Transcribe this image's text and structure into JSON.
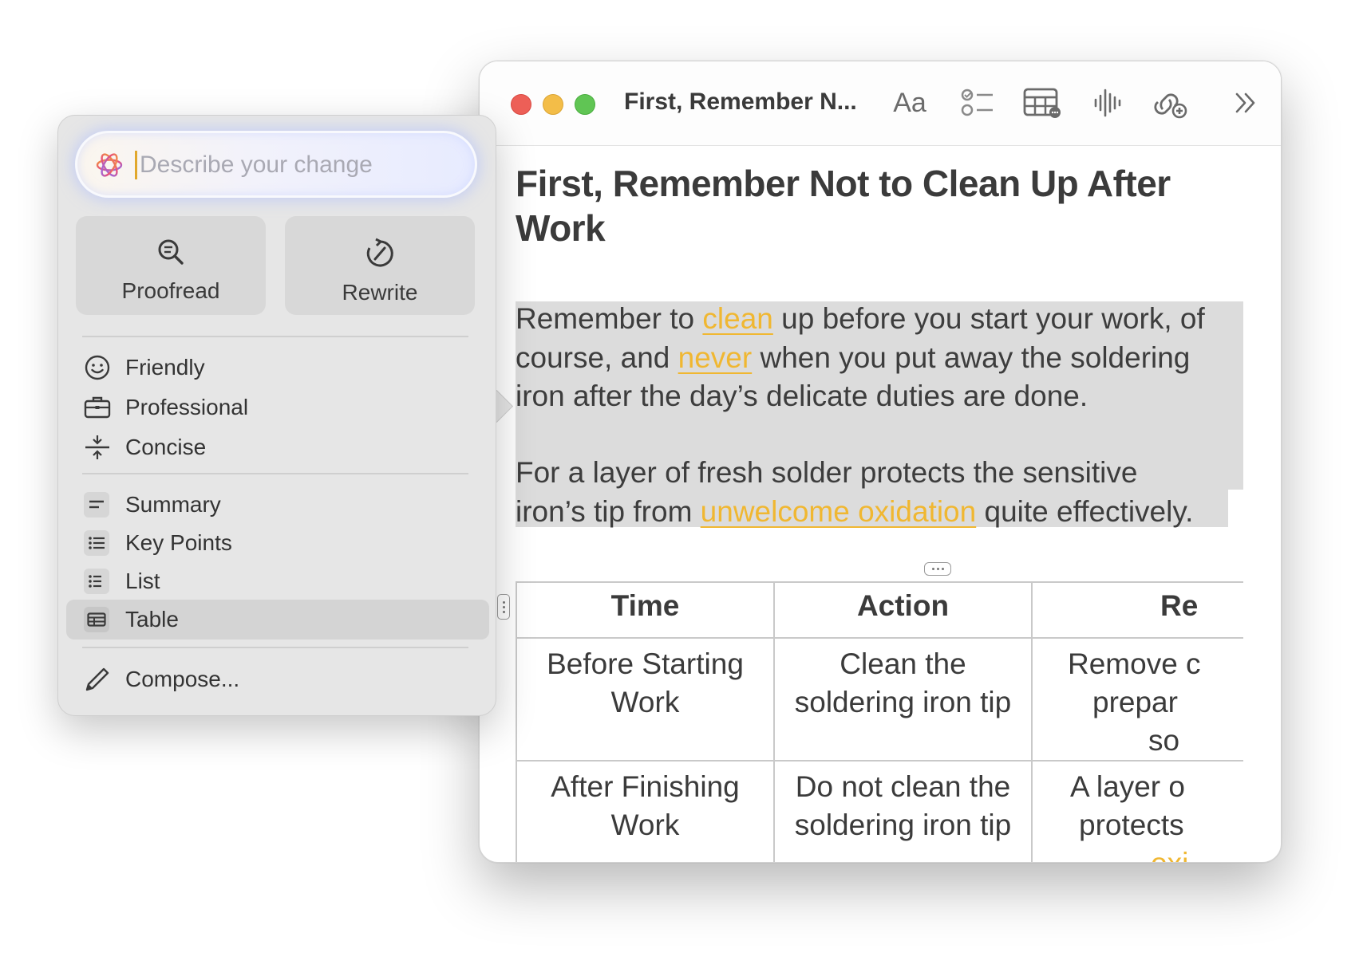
{
  "window": {
    "title": "First, Remember N...",
    "font_button": "Aa"
  },
  "document": {
    "title": "First, Remember Not to Clean Up After Work",
    "para1": {
      "a": "Remember to ",
      "b": "clean",
      "c": " up before you start your work, of",
      "d": "course, and ",
      "e": "never",
      "f": " when you put away the soldering",
      "g": "iron after the day’s delicate duties are done."
    },
    "para2": {
      "a": "For a layer of fresh solder protects the sensitive",
      "b": "iron’s tip from ",
      "c": "unwelcome oxidation",
      "d": " quite effectively."
    },
    "table": {
      "headers": [
        "Time",
        "Action",
        "Re"
      ],
      "rows": [
        [
          "Before Starting Work",
          "Clean the soldering iron tip",
          [
            "Remove c",
            "prepar",
            "so"
          ]
        ],
        [
          "After Finishing Work",
          "Do not clean the soldering iron tip",
          [
            "A layer o",
            "protects",
            "oxi"
          ]
        ]
      ]
    }
  },
  "writing_tools": {
    "describe_placeholder": "Describe your change",
    "proofread_label": "Proofread",
    "rewrite_label": "Rewrite",
    "items": {
      "friendly": "Friendly",
      "professional": "Professional",
      "concise": "Concise",
      "summary": "Summary",
      "key_points": "Key Points",
      "list": "List",
      "table": "Table",
      "compose": "Compose..."
    },
    "selected_item": "Table"
  },
  "colors": {
    "highlight": "#f0b731",
    "close": "#ed5f57",
    "minimize": "#f3bd48",
    "maximize": "#60c554"
  }
}
